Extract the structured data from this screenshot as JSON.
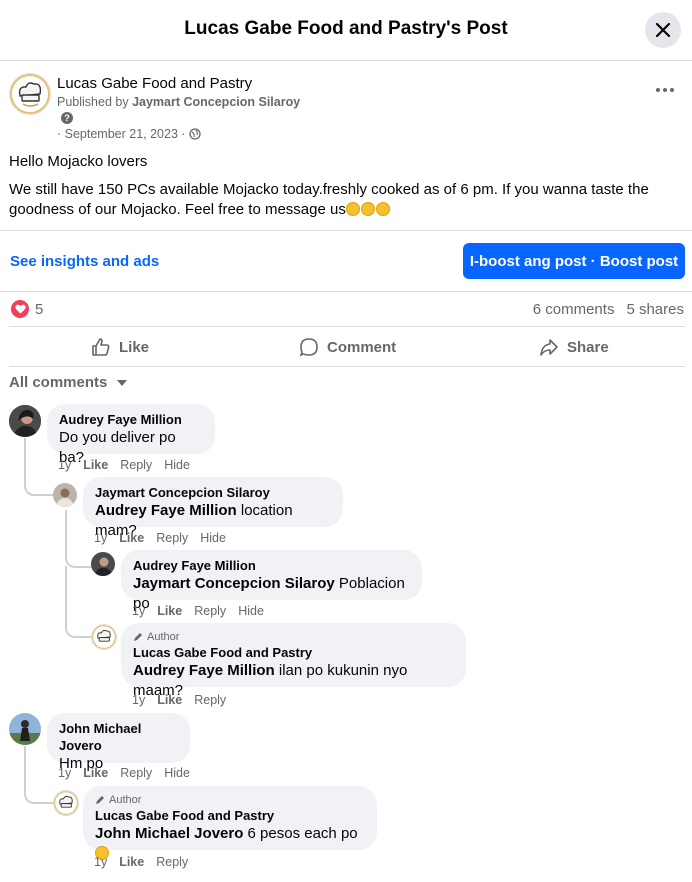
{
  "header": {
    "title": "Lucas Gabe Food and Pastry's Post"
  },
  "post": {
    "page_name": "Lucas Gabe Food and Pastry",
    "published_prefix": "Published by ",
    "published_by": "Jaymart Concepcion Silaroy",
    "help_glyph": "?",
    "date": "· September 21, 2023 ·",
    "greeting": "Hello Mojacko lovers",
    "body": "We still have 150 PCs available Mojacko today.freshly cooked as of 6 pm. If you wanna taste the goodness of our Mojacko. Feel free to message us"
  },
  "actions_bar": {
    "insights": "See insights and ads",
    "boost": "I-boost ang post · Boost post"
  },
  "stats": {
    "reactions": "5",
    "comments": "6 comments",
    "shares": "5 shares"
  },
  "buttons": {
    "like": "Like",
    "comment": "Comment",
    "share": "Share"
  },
  "filter": {
    "label": "All comments"
  },
  "comments": [
    {
      "name": "Audrey Faye Million",
      "mention": "",
      "text": "Do you deliver po ba?",
      "age": "1y",
      "like": "Like",
      "reply": "Reply",
      "hide": "Hide"
    },
    {
      "name": "Jaymart Concepcion Silaroy",
      "mention": "Audrey Faye Million",
      "text": " location mam?",
      "age": "1y",
      "like": "Like",
      "reply": "Reply",
      "hide": "Hide"
    },
    {
      "name": "Audrey Faye Million",
      "mention": "Jaymart Concepcion Silaroy",
      "text": " Poblacion po",
      "age": "1y",
      "like": "Like",
      "reply": "Reply",
      "hide": "Hide"
    },
    {
      "author": "Author",
      "name": "Lucas Gabe Food and Pastry",
      "mention": "Audrey Faye Million",
      "text": " ilan po kukunin nyo maam?",
      "age": "1y",
      "like": "Like",
      "reply": "Reply"
    },
    {
      "name": "John Michael Jovero",
      "mention": "",
      "text": "Hm po",
      "age": "1y",
      "like": "Like",
      "reply": "Reply",
      "hide": "Hide"
    },
    {
      "author": "Author",
      "name": "Lucas Gabe Food and Pastry",
      "mention": "John Michael Jovero",
      "text": " 6 pesos each po ",
      "age": "1y",
      "like": "Like",
      "reply": "Reply"
    }
  ],
  "colors": {
    "accent": "#0866ff",
    "love": "#f33e58",
    "muted": "#65676b",
    "bubble": "#f0f2f5"
  }
}
